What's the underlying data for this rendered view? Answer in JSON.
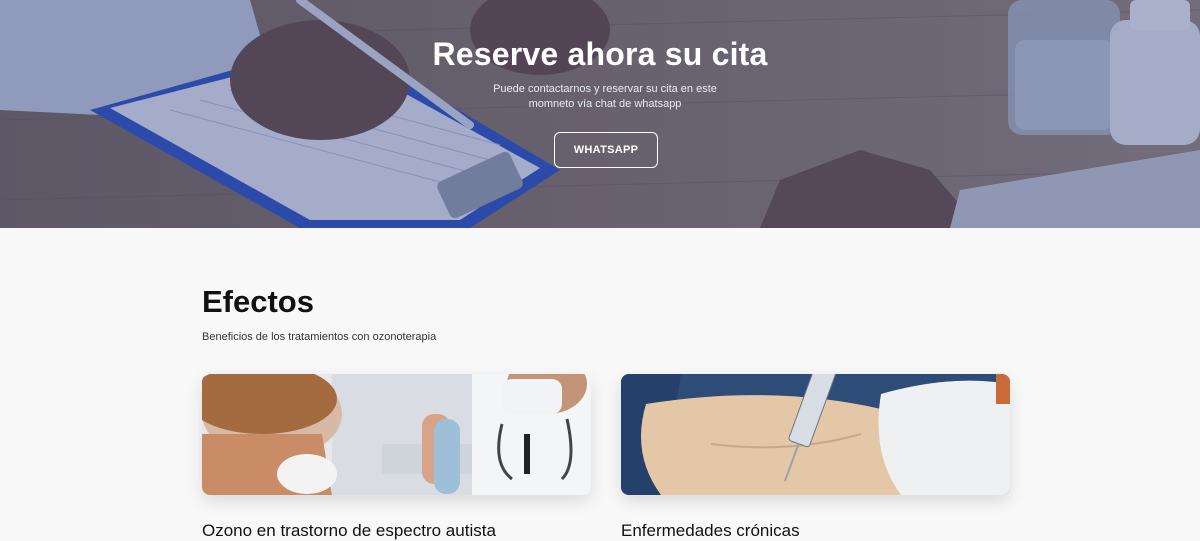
{
  "hero": {
    "title": "Reserve ahora su cita",
    "subtitle": "Puede contactarnos y reservar su cita en este momneto vía chat de whatsapp",
    "button_label": "WHATSAPP"
  },
  "effects": {
    "title": "Efectos",
    "subtitle": "Beneficios de los tratamientos con ozonoterapia",
    "cards": [
      {
        "title": "Ozono en trastorno de espectro autista",
        "image": "child-doctor-high-five-photo"
      },
      {
        "title": "Enfermedades crónicas",
        "image": "syringe-injection-photo"
      }
    ]
  },
  "colors": {
    "hero_overlay": "#3d4f86",
    "background": "#f8f8f9",
    "text": "#111111"
  }
}
